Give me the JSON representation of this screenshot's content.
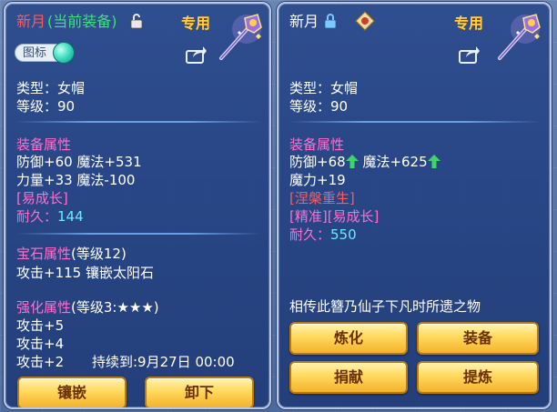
{
  "left": {
    "title_name": "新月",
    "title_status": "(当前装备)",
    "tag": "专用",
    "badge": "图标",
    "type_line": "类型：女帽",
    "level_line": "等级：90",
    "equip_attr_heading": "装备属性",
    "equip_line1": "防御+60 魔法+531",
    "equip_line2": "力量+33 魔法-100",
    "special": "[易成长]",
    "durability_label": "耐久：",
    "durability_value": "144",
    "gem_heading": "宝石属性",
    "gem_level": "(等级12)",
    "gem_line": "攻击+115 镶嵌太阳石",
    "enhance_heading": "强化属性",
    "enhance_level": "(等级3:★★★)",
    "enhance_line1": "攻击+5",
    "enhance_line2": "攻击+4",
    "enhance_line3": "攻击+2",
    "enhance_duration": "持续到:9月27日 00:00",
    "btn_inlay": "镶嵌",
    "btn_unequip": "卸下"
  },
  "right": {
    "title_name": "新月",
    "tag": "专用",
    "type_line": "类型：女帽",
    "level_line": "等级：90",
    "equip_attr_heading": "装备属性",
    "equip_def": "防御+68",
    "equip_magic": "魔法+625",
    "equip_line2": "魔力+19",
    "special1": "[涅槃重生]",
    "special2": "[精准][易成长]",
    "durability_label": "耐久：",
    "durability_value": "550",
    "description": "相传此簪乃仙子下凡时所遗之物",
    "btn_refine": "炼化",
    "btn_equip": "装备",
    "btn_donate": "捐献",
    "btn_extract": "提炼"
  },
  "icons": {
    "lock_open": "unlocked-lock-icon",
    "lock_closed": "locked-lock-icon",
    "share": "share-icon",
    "gem": "gem-orb-icon",
    "hairpin": "hairpin-item-icon",
    "up_arrow": "green-up-arrow-icon",
    "seal": "seal-badge-icon"
  },
  "colors": {
    "name_red": "#ff5a5a",
    "heading_pink": "#ff6fd0",
    "special_pink": "#ff6fd0",
    "durability_cyan": "#6fe8ff",
    "tag_gold": "#ffcf4a",
    "button_gold": "#ffd85c",
    "arrow_green": "#3fd46a"
  }
}
